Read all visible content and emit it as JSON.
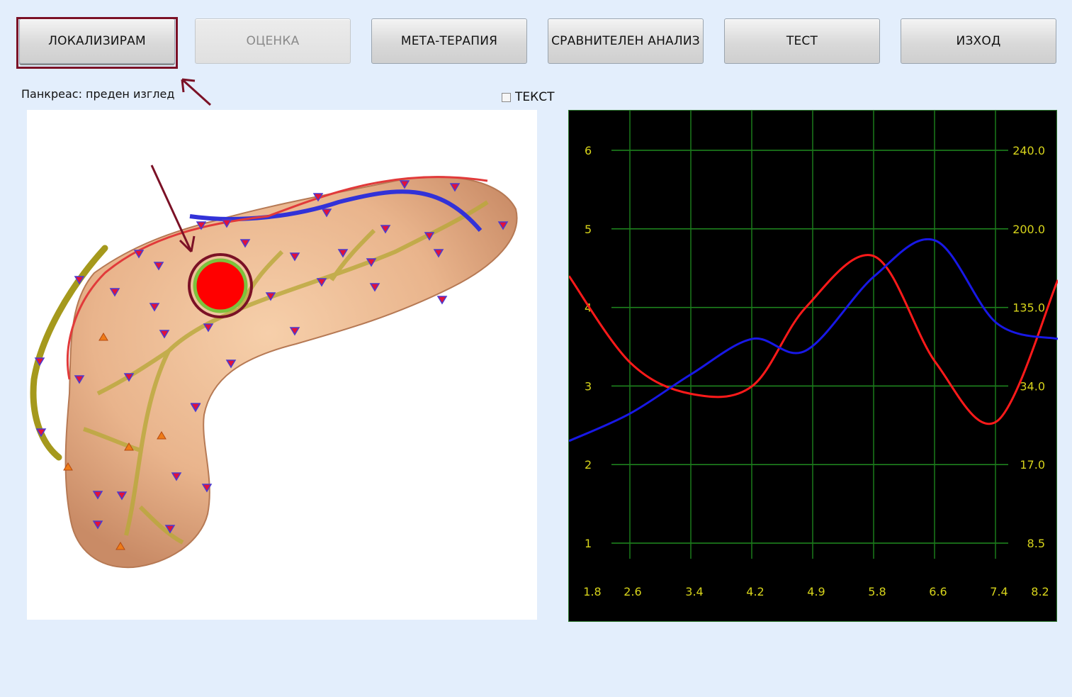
{
  "toolbar": {
    "buttons": [
      {
        "label": "ЛОКАЛИЗИРАМ",
        "state": "active"
      },
      {
        "label": "ОЦЕНКА",
        "state": "disabled"
      },
      {
        "label": "МЕТА-ТЕРАПИЯ",
        "state": "normal"
      },
      {
        "label": "СРАВНИТЕЛЕН АНАЛИЗ",
        "state": "normal"
      },
      {
        "label": "ТЕСТ",
        "state": "normal"
      },
      {
        "label": "ИЗХОД",
        "state": "normal"
      }
    ]
  },
  "view_label": "Панкреас: преден изглед",
  "text_checkbox": {
    "label": "ТЕКСТ",
    "checked": false
  },
  "colors": {
    "accent_frame": "#7b1126",
    "red_series": "#ff1a1a",
    "blue_series": "#1818e6",
    "grid": "#1f8a1f",
    "axis_text": "#d7d41b"
  },
  "chart_data": {
    "type": "line",
    "x_ticks": [
      "1.8",
      "2.6",
      "3.4",
      "4.2",
      "4.9",
      "5.8",
      "6.6",
      "7.4",
      "8.2"
    ],
    "y_left_ticks": [
      "1",
      "2",
      "3",
      "4",
      "5",
      "6"
    ],
    "y_right_ticks": [
      "8.5",
      "17.0",
      "34.0",
      "135.0",
      "200.0",
      "240.0"
    ],
    "ylim": [
      1,
      6
    ],
    "series": [
      {
        "color": "#ff1a1a",
        "x": [
          1.8,
          2.6,
          3.4,
          4.2,
          4.9,
          5.8,
          6.6,
          7.4,
          8.2
        ],
        "y": [
          4.4,
          3.3,
          2.9,
          3.0,
          4.0,
          4.65,
          3.3,
          2.55,
          4.35
        ]
      },
      {
        "color": "#1818e6",
        "x": [
          1.8,
          2.6,
          3.4,
          4.2,
          4.9,
          5.8,
          6.6,
          7.4,
          8.2
        ],
        "y": [
          2.3,
          2.65,
          3.15,
          3.6,
          3.45,
          4.4,
          4.85,
          3.8,
          3.6
        ]
      }
    ]
  }
}
